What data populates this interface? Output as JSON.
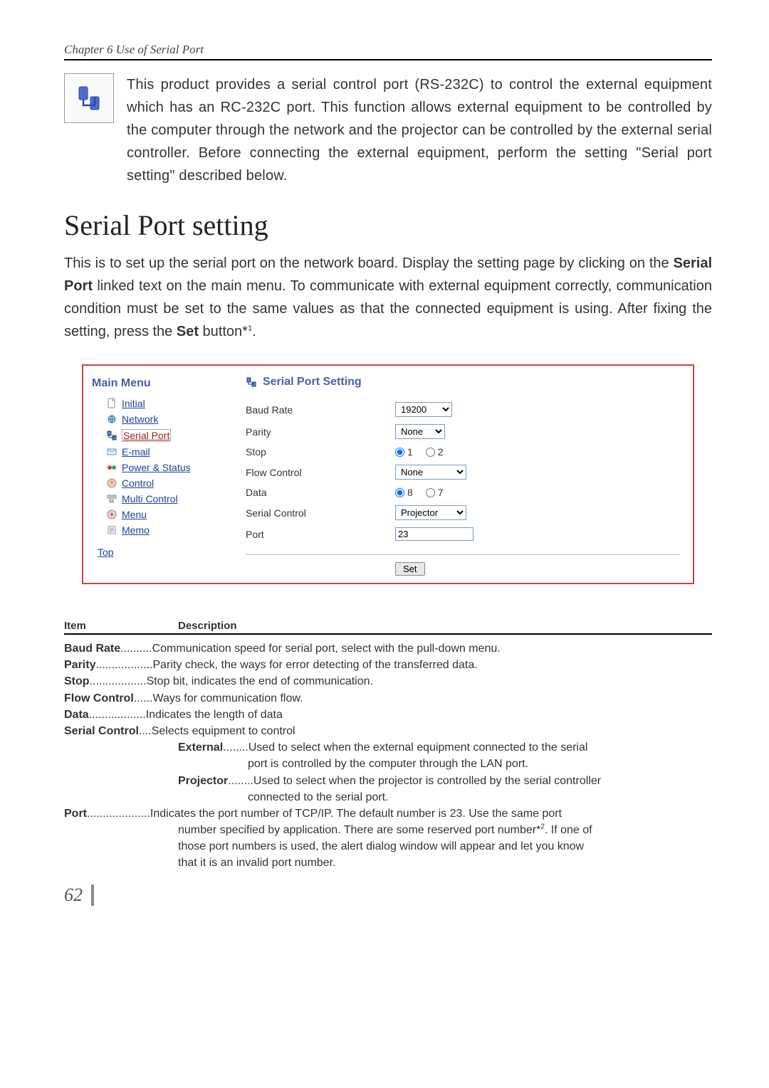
{
  "chapter": "Chapter 6 Use of Serial Port",
  "intro": "This product provides a serial control port (RS-232C) to control the external equipment which has an RC-232C port. This function allows external equipment to be controlled by the computer through the network and the projector can be controlled by the external serial controller. Before connecting the external equipment, perform the setting \"Serial port setting\" described below.",
  "section_title": "Serial Port setting",
  "explain_a": "This is to set up the serial port on the network board. Display the setting page by clicking on the ",
  "explain_bold": "Serial Port",
  "explain_b": " linked text on the main menu. To communicate with external equipment correctly, communication condition must be set to the same values as that the connected equipment is using. After fixing the setting, press the ",
  "explain_bold2": "Set",
  "explain_c": " button*",
  "explain_sup": "1",
  "explain_d": ".",
  "menu": {
    "title": "Main Menu",
    "items": {
      "initial": "Initial",
      "network": "Network",
      "serial": "Serial Port",
      "email": "E-mail",
      "power": "Power & Status",
      "control": "Control",
      "multi": "Multi Control",
      "menu": "Menu",
      "memo": "Memo"
    },
    "top": "Top"
  },
  "settings": {
    "title": "Serial Port Setting",
    "rows": {
      "baud": {
        "label": "Baud Rate",
        "value": "19200"
      },
      "parity": {
        "label": "Parity",
        "value": "None"
      },
      "stop": {
        "label": "Stop",
        "opt1": "1",
        "opt2": "2"
      },
      "flow": {
        "label": "Flow Control",
        "value": "None"
      },
      "data": {
        "label": "Data",
        "opt1": "8",
        "opt2": "7"
      },
      "serial_control": {
        "label": "Serial Control",
        "value": "Projector"
      },
      "port": {
        "label": "Port",
        "value": "23"
      }
    },
    "set_btn": "Set"
  },
  "desc_head": {
    "item": "Item",
    "description": "Description"
  },
  "desc": {
    "baud": {
      "term": "Baud Rate",
      "dots": "..........",
      "def": "Communication speed for serial port, select with the pull-down menu."
    },
    "parity": {
      "term": "Parity",
      "dots": "..................",
      "def": "Parity check, the ways for error detecting of the transferred data."
    },
    "stop": {
      "term": "Stop ",
      "dots": "..................",
      "def": "Stop bit, indicates the end of communication."
    },
    "flow": {
      "term": "Flow Control ",
      "dots": "......",
      "def": "Ways for communication flow."
    },
    "data": {
      "term": "Data ",
      "dots": "..................",
      "def": "Indicates the length of data"
    },
    "serial": {
      "term": "Serial Control ",
      "dots": "....",
      "def": "Selects equipment to control"
    },
    "external": {
      "term": "External ",
      "dots": "........",
      "def": "Used to select when the external equipment connected to the serial",
      "cont": "port is controlled by the computer through the LAN port."
    },
    "projector": {
      "term": "Projector",
      "dots": "........",
      "def": "Used to select when the projector is controlled by the serial controller",
      "cont": "connected to the serial port."
    },
    "port": {
      "term": "Port",
      "dots": "....................",
      "def": "Indicates the port number of TCP/IP. The default number is 23. Use the same port",
      "cont1": "number specified by application. There are some reserved port number*",
      "note": "2",
      "cont1b": ". If one of",
      "cont2": "those port numbers is used, the alert dialog window will appear and let you know",
      "cont3": "that it is an invalid port number."
    }
  },
  "page_num": "62"
}
